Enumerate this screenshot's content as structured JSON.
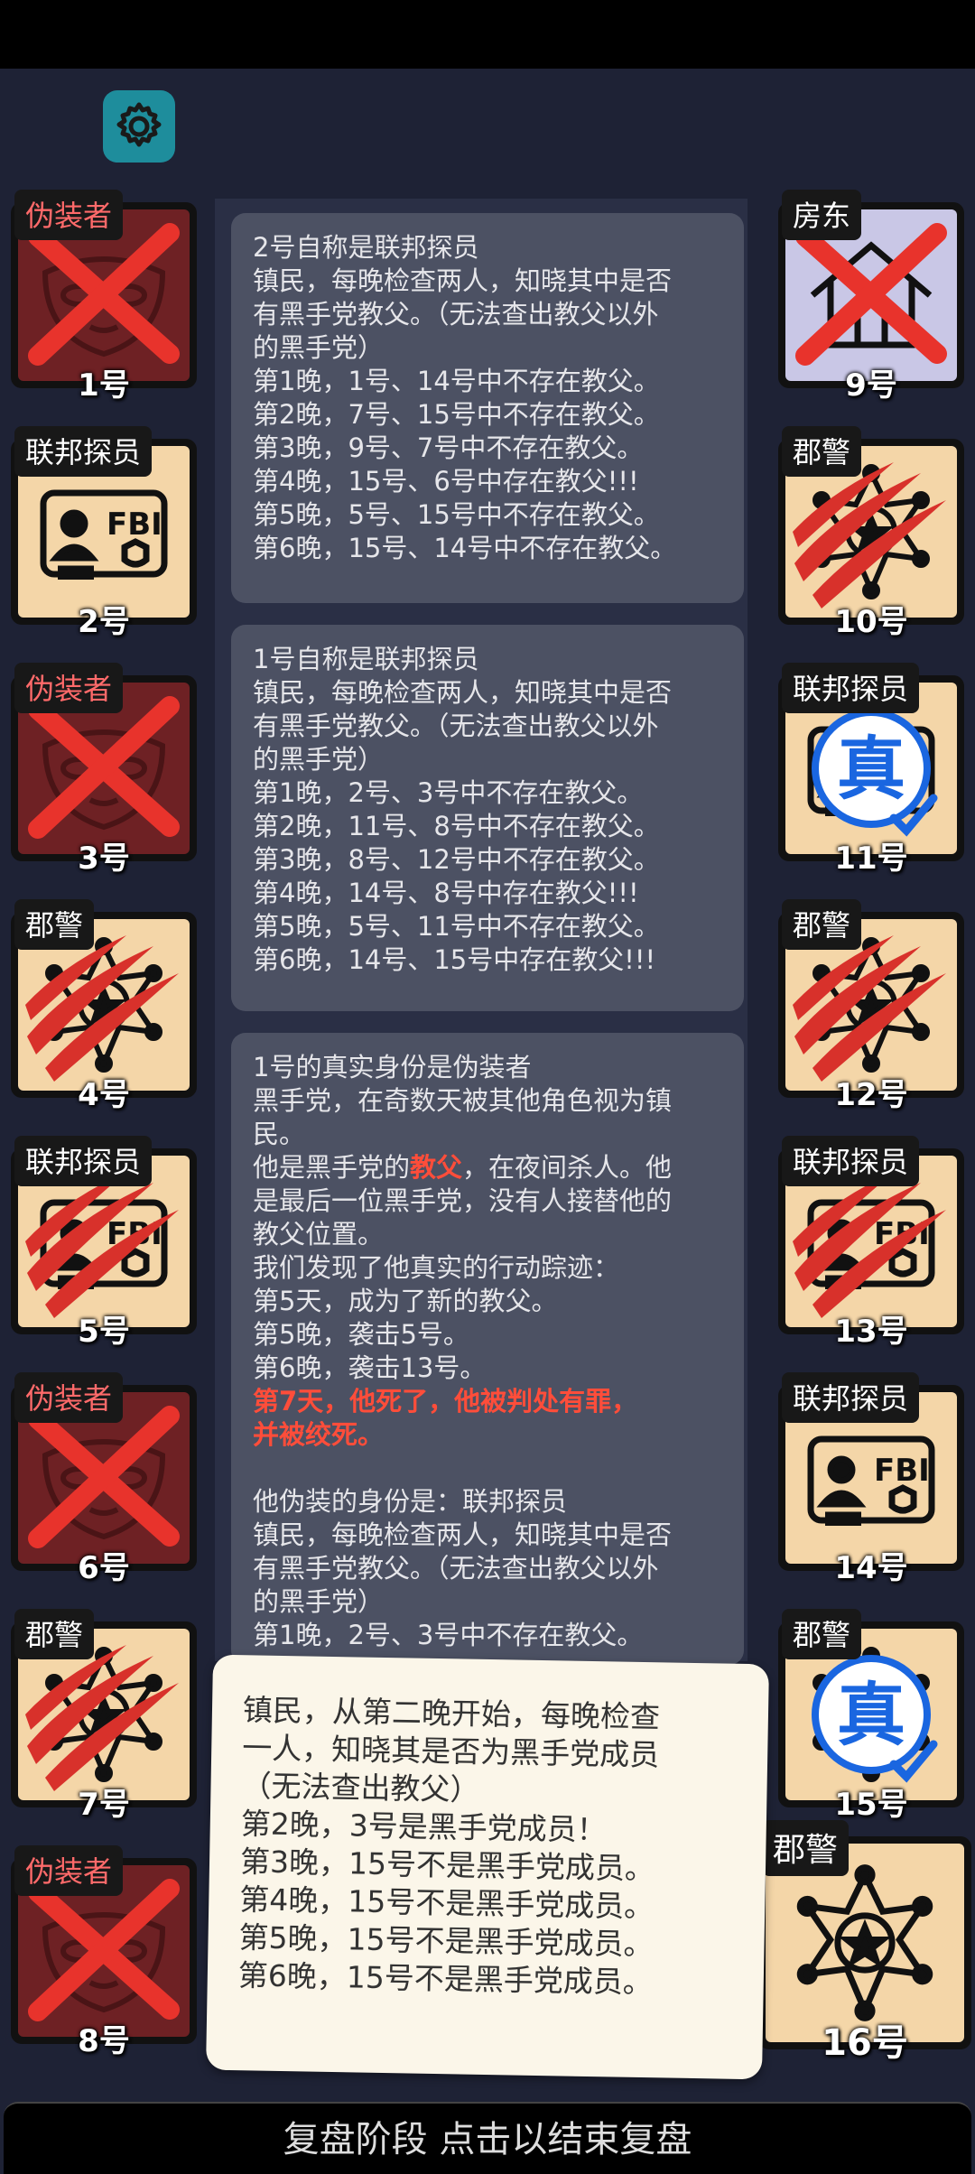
{
  "settings": {
    "icon": "gear-icon"
  },
  "players": [
    {
      "num": "1号",
      "role": "伪装者",
      "red": true,
      "type": "mask",
      "mark": "cross"
    },
    {
      "num": "2号",
      "role": "联邦探员",
      "red": false,
      "type": "fbi",
      "mark": "none"
    },
    {
      "num": "3号",
      "role": "伪装者",
      "red": true,
      "type": "mask",
      "mark": "cross"
    },
    {
      "num": "4号",
      "role": "郡警",
      "red": false,
      "type": "sheriff",
      "mark": "claw"
    },
    {
      "num": "5号",
      "role": "联邦探员",
      "red": false,
      "type": "fbi",
      "mark": "claw"
    },
    {
      "num": "6号",
      "role": "伪装者",
      "red": true,
      "type": "mask",
      "mark": "cross"
    },
    {
      "num": "7号",
      "role": "郡警",
      "red": false,
      "type": "sheriff",
      "mark": "claw"
    },
    {
      "num": "8号",
      "role": "伪装者",
      "red": true,
      "type": "mask",
      "mark": "cross"
    },
    {
      "num": "9号",
      "role": "房东",
      "red": false,
      "type": "house",
      "mark": "cross"
    },
    {
      "num": "10号",
      "role": "郡警",
      "red": false,
      "type": "sheriff",
      "mark": "claw"
    },
    {
      "num": "11号",
      "role": "联邦探员",
      "red": false,
      "type": "fbi",
      "mark": "true"
    },
    {
      "num": "12号",
      "role": "郡警",
      "red": false,
      "type": "sheriff",
      "mark": "claw"
    },
    {
      "num": "13号",
      "role": "联邦探员",
      "red": false,
      "type": "fbi",
      "mark": "claw"
    },
    {
      "num": "14号",
      "role": "联邦探员",
      "red": false,
      "type": "fbi",
      "mark": "none"
    },
    {
      "num": "15号",
      "role": "郡警",
      "red": false,
      "type": "sheriff",
      "mark": "true"
    },
    {
      "num": "16号",
      "role": "郡警",
      "red": false,
      "type": "sheriff",
      "mark": "none"
    }
  ],
  "true_mark": "真",
  "messages": [
    {
      "lines": [
        {
          "text": "2号自称是联邦探员"
        },
        {
          "text": "镇民，每晚检查两人，知晓其中是否"
        },
        {
          "text": "有黑手党教父。（无法查出教父以外"
        },
        {
          "text": "的黑手党）"
        },
        {
          "text": "第1晚，1号、14号中不存在教父。"
        },
        {
          "text": "第2晚，7号、15号中不存在教父。"
        },
        {
          "text": "第3晚，9号、7号中不存在教父。"
        },
        {
          "text": "第4晚，15号、6号中存在教父!!!"
        },
        {
          "text": "第5晚，5号、15号中不存在教父。"
        },
        {
          "text": "第6晚，15号、14号中不存在教父。"
        }
      ]
    },
    {
      "lines": [
        {
          "text": "1号自称是联邦探员"
        },
        {
          "text": "镇民，每晚检查两人，知晓其中是否"
        },
        {
          "text": "有黑手党教父。（无法查出教父以外"
        },
        {
          "text": "的黑手党）"
        },
        {
          "text": "第1晚，2号、3号中不存在教父。"
        },
        {
          "text": "第2晚，11号、8号中不存在教父。"
        },
        {
          "text": "第3晚，8号、12号中不存在教父。"
        },
        {
          "text": "第4晚，14号、8号中存在教父!!!"
        },
        {
          "text": "第5晚，5号、11号中不存在教父。"
        },
        {
          "text": "第6晚，14号、15号中存在教父!!!"
        }
      ]
    },
    {
      "lines": [
        {
          "text": "1号的真实身份是伪装者"
        },
        {
          "text": "黑手党，在奇数天被其他角色视为镇"
        },
        {
          "text": "民。"
        },
        {
          "pre": "他是黑手党的",
          "red": "教父",
          "post": "，在夜间杀人。他"
        },
        {
          "text": "是最后一位黑手党，没有人接替他的"
        },
        {
          "text": "教父位置。"
        },
        {
          "text": "我们发现了他真实的行动踪迹："
        },
        {
          "text": "第5天，成为了新的教父。"
        },
        {
          "text": "第5晚，袭击5号。"
        },
        {
          "text": "第6晚，袭击13号。"
        },
        {
          "red_line": "第7天，他死了，他被判处有罪，"
        },
        {
          "red_line": "并被绞死。"
        },
        {
          "text": ""
        },
        {
          "text": "他伪装的身份是：联邦探员"
        },
        {
          "text": "镇民，每晚检查两人，知晓其中是否"
        },
        {
          "text": "有黑手党教父。（无法查出教父以外"
        },
        {
          "text": "的黑手党）"
        },
        {
          "text": "第1晚，2号、3号中不存在教父。"
        }
      ]
    }
  ],
  "tooltip": {
    "lines": [
      "镇民，从第二晚开始，每晚检查",
      "一人，知晓其是否为黑手党成员",
      "（无法查出教父）",
      "第2晚，3号是黑手党成员！",
      "第3晚，15号不是黑手党成员。",
      "第4晚，15号不是黑手党成员。",
      "第5晚，15号不是黑手党成员。",
      "第6晚，15号不是黑手党成员。"
    ]
  },
  "bottom_bar": {
    "label": "复盘阶段 点击以结束复盘"
  }
}
